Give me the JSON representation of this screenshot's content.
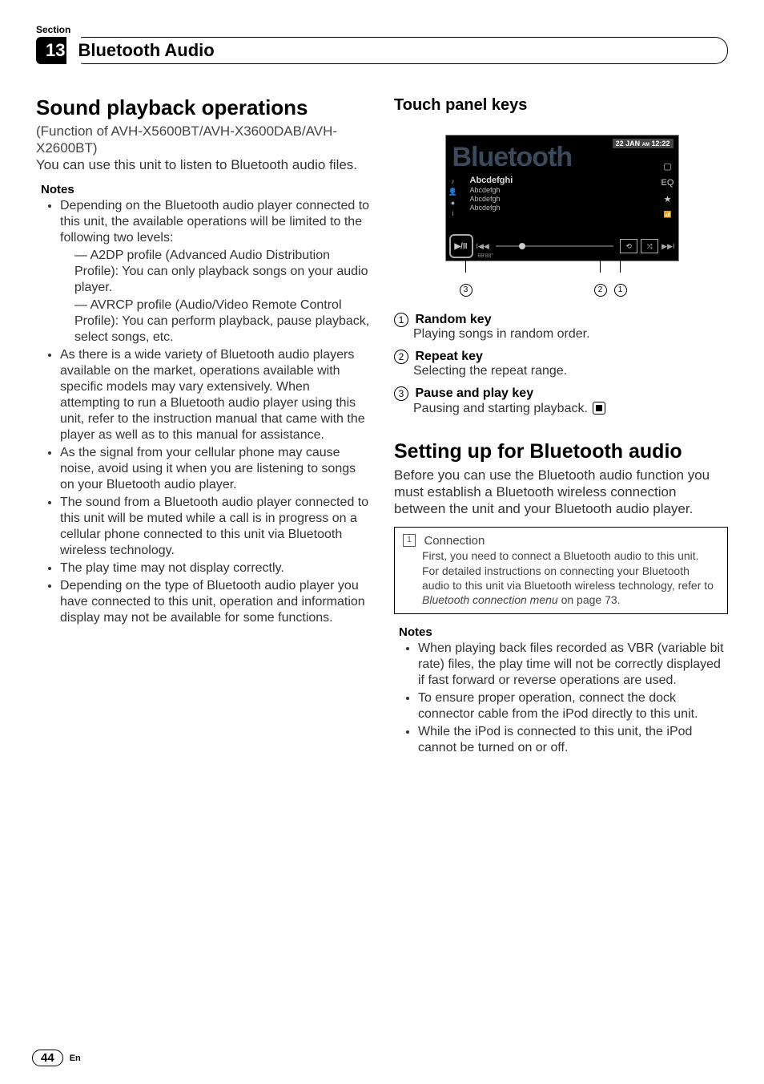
{
  "section_label": "Section",
  "chapter_number": "13",
  "chapter_title": "Bluetooth Audio",
  "left": {
    "h1": "Sound playback operations",
    "sub": "(Function of AVH-X5600BT/AVH-X3600DAB/AVH-X2600BT)",
    "intro": "You can use this unit to listen to Bluetooth audio files.",
    "notes_label": "Notes",
    "bullets": [
      {
        "text": "Depending on the Bluetooth audio player connected to this unit, the available operations will be limited to the following two levels:",
        "sub": [
          "— A2DP profile (Advanced Audio Distribution Profile): You can only playback songs on your audio player.",
          "— AVRCP profile (Audio/Video Remote Control Profile): You can perform playback, pause playback, select songs, etc."
        ]
      },
      {
        "text": "As there is a wide variety of Bluetooth audio players available on the market, operations available with specific models may vary extensively. When attempting to run a Bluetooth audio player using this unit, refer to the instruction manual that came with the player as well as to this manual for assistance."
      },
      {
        "text": "As the signal from your cellular phone may cause noise, avoid using it when you are listening to songs on your Bluetooth audio player."
      },
      {
        "text": "The sound from a Bluetooth audio player connected to this unit will be muted while a call is in progress on a cellular phone connected to this unit via Bluetooth wireless technology."
      },
      {
        "text": "The play time may not display correctly."
      },
      {
        "text": "Depending on the type of Bluetooth audio player you have connected to this unit, operation and information display may not be available for some functions."
      }
    ]
  },
  "right": {
    "touch_h": "Touch panel keys",
    "screen": {
      "word": "Bluetooth",
      "date": "22 JAN",
      "ampm": "AM",
      "clock": "12:22",
      "track_title": "Abcdefghi",
      "meta_lines": [
        "Abcdefgh",
        "Abcdefgh",
        "Abcdefgh"
      ],
      "play_pause": "▶/II",
      "time_label": "88'88\"",
      "repeat_glyph": "⟲",
      "random_glyph": "⤨",
      "eq_glyph": "EQ",
      "star_glyph": "★"
    },
    "keys": [
      {
        "n": "1",
        "h": "Random key",
        "b": "Playing songs in random order."
      },
      {
        "n": "2",
        "h": "Repeat key",
        "b": "Selecting the repeat range."
      },
      {
        "n": "3",
        "h": "Pause and play key",
        "b": "Pausing and starting playback."
      }
    ],
    "setup_h": "Setting up for Bluetooth audio",
    "setup_p": "Before you can use the Bluetooth audio function you must establish a Bluetooth wireless connection between the unit and your Bluetooth audio player.",
    "conn": {
      "n": "1",
      "title": "Connection",
      "l1": "First, you need to connect a Bluetooth audio to this unit.",
      "l2a": "For detailed instructions on connecting your Bluetooth audio to this unit via Bluetooth wireless technology, refer to ",
      "l2em": "Bluetooth connection menu",
      "l2b": " on page 73."
    },
    "notes_label": "Notes",
    "notes": [
      "When playing back files recorded as VBR (variable bit rate) files, the play time will not be correctly displayed if fast forward or reverse operations are used.",
      "To ensure proper operation, connect the dock connector cable from the iPod directly to this unit.",
      "While the iPod is connected to this unit, the iPod cannot be turned on or off."
    ]
  },
  "page_number": "44",
  "lang": "En"
}
